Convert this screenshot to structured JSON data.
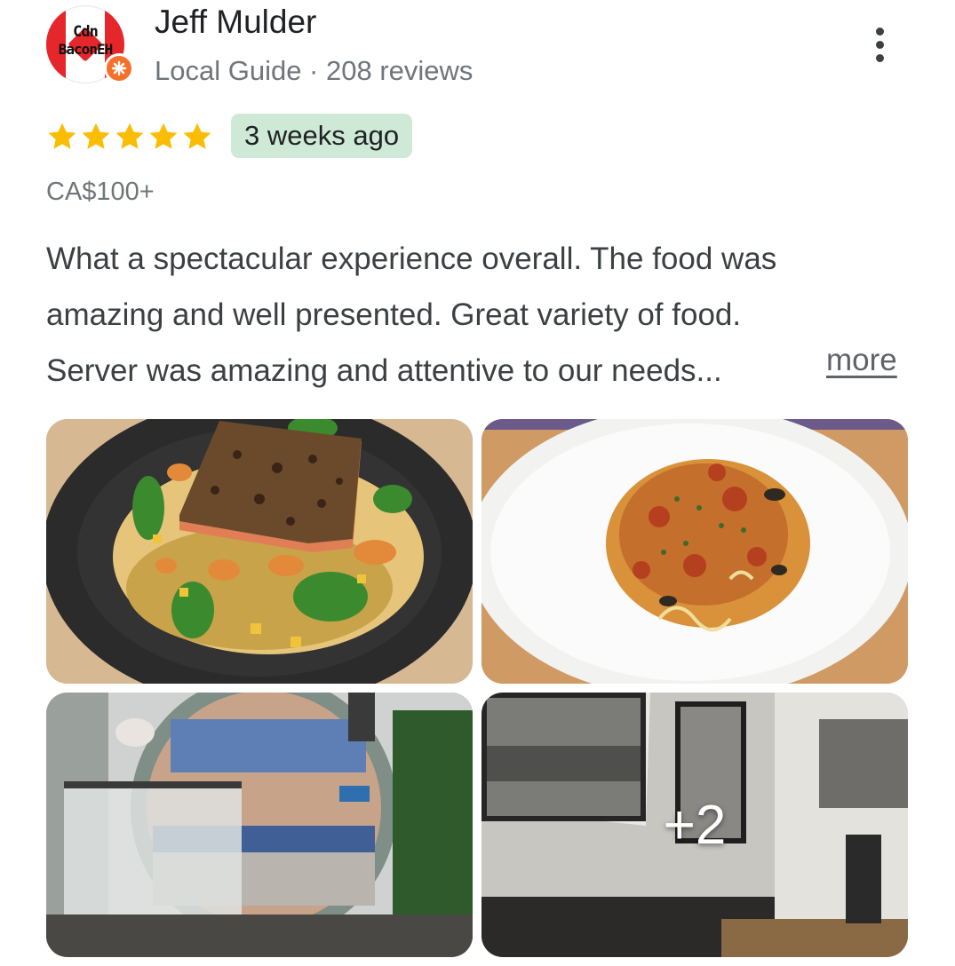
{
  "reviewer": {
    "avatar_text_line1": "Cdn",
    "avatar_text_line2": "BaconEH",
    "name": "Jeff Mulder",
    "meta": "Local Guide · 208 reviews",
    "badge_icon": "local-guide-star-icon",
    "avatar_colors": {
      "red": "#e5262b",
      "badge": "#f5712b"
    }
  },
  "review": {
    "rating": 5,
    "rating_max": 5,
    "star_color": "#fbbc04",
    "time_ago": "3 weeks ago",
    "time_badge_color": "#ceead6",
    "price": "CA$100+",
    "text_lines": [
      "What a spectacular experience overall. The food was",
      "amazing and well presented. Great variety of food.",
      "Server was amazing and attentive to our needs..."
    ],
    "more_label": "more"
  },
  "photos": {
    "items": [
      {
        "subject": "salmon dish on dark plate"
      },
      {
        "subject": "spaghetti with seafood in white bowl"
      },
      {
        "subject": "restaurant interior with round window"
      },
      {
        "subject": "restaurant dining room with framed photos"
      }
    ],
    "extra_count_label": "+2"
  },
  "icons": {
    "menu": "more-vert-icon",
    "star": "star-icon"
  }
}
